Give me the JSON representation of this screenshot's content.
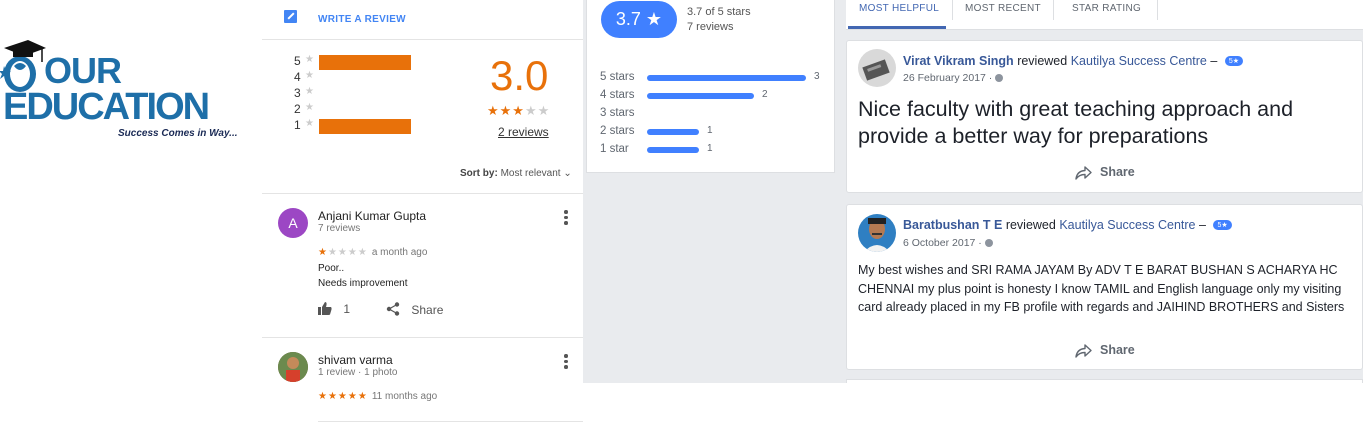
{
  "logo": {
    "line1": "OUR",
    "line2": "EDUCATION",
    "tagline": "Success Comes in Way...",
    "icon": "graduate-globe-icon"
  },
  "google": {
    "write_review": "WRITE A REVIEW",
    "histogram": [
      {
        "stars": "5",
        "fraction": 1.0
      },
      {
        "stars": "4",
        "fraction": 0.0
      },
      {
        "stars": "3",
        "fraction": 0.0
      },
      {
        "stars": "2",
        "fraction": 0.0
      },
      {
        "stars": "1",
        "fraction": 1.0
      }
    ],
    "average": "3.0",
    "average_stars": 3,
    "reviews_link": "2 reviews",
    "sort_label": "Sort by:",
    "sort_value": "Most relevant",
    "reviews": [
      {
        "initial": "A",
        "avatar_color": "#9c47c4",
        "name": "Anjani Kumar Gupta",
        "meta": "7 reviews",
        "rating": 1,
        "when": "a month ago",
        "text1": "Poor..",
        "text2": "Needs improvement",
        "likes": "1",
        "share": "Share"
      },
      {
        "name": "shivam varma",
        "meta": "1 review · 1 photo",
        "rating": 5,
        "when": "11 months ago"
      }
    ]
  },
  "fb_summary": {
    "score": "3.7 ★",
    "of_stars": "3.7 of 5 stars",
    "count": "7 reviews",
    "rows": [
      {
        "label": "5 stars",
        "count": "3",
        "fraction": 1.0
      },
      {
        "label": "4 stars",
        "count": "2",
        "fraction": 0.67
      },
      {
        "label": "3 stars",
        "count": "",
        "fraction": 0
      },
      {
        "label": "2 stars",
        "count": "1",
        "fraction": 0.33
      },
      {
        "label": "1 star",
        "count": "1",
        "fraction": 0.33
      }
    ]
  },
  "tabs": [
    "MOST HELPFUL",
    "MOST RECENT",
    "STAR RATING"
  ],
  "fb_reviews": [
    {
      "name": "Virat Vikram Singh",
      "verb": "reviewed",
      "page": "Kautilya Success Centre",
      "dash": "–",
      "badge": "5★",
      "date": "26 February 2017 ·",
      "text": "Nice faculty with great teaching approach and provide a better way for preparations",
      "share": "Share"
    },
    {
      "name": "Baratbushan T E",
      "verb": "reviewed",
      "page": "Kautilya Success Centre",
      "dash": "–",
      "badge": "5★",
      "date": "6 October 2017 ·",
      "text": "My best wishes and SRI RAMA JAYAM By ADV T E BARAT BUSHAN S ACHARYA HC CHENNAI my plus point is honesty I know TAMIL and English language only my visiting card already placed in my FB profile with regards and JAIHIND BROTHERS and Sisters",
      "share": "Share"
    }
  ],
  "colors": {
    "google_orange": "#e8710a",
    "google_blue": "#4285f4",
    "fb_blue": "#4080ff",
    "fb_link": "#385898",
    "logo_blue": "#1e6fa8"
  }
}
